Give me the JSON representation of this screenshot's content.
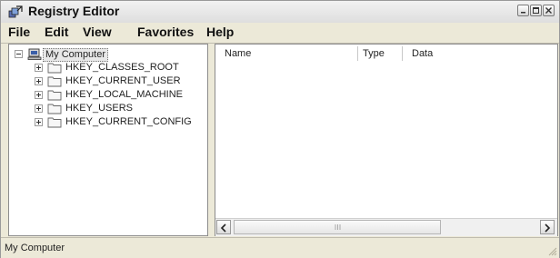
{
  "window": {
    "title": "Registry Editor",
    "icon": "registry-editor-icon"
  },
  "menu": {
    "items": [
      "File",
      "Edit",
      "View",
      "Favorites",
      "Help"
    ]
  },
  "tree": {
    "root": {
      "label": "My Computer",
      "icon": "computer-icon",
      "expanded": true
    },
    "children": [
      {
        "label": "HKEY_CLASSES_ROOT",
        "icon": "folder-icon"
      },
      {
        "label": "HKEY_CURRENT_USER",
        "icon": "folder-icon"
      },
      {
        "label": "HKEY_LOCAL_MACHINE",
        "icon": "folder-icon"
      },
      {
        "label": "HKEY_USERS",
        "icon": "folder-icon"
      },
      {
        "label": "HKEY_CURRENT_CONFIG",
        "icon": "folder-icon"
      }
    ]
  },
  "list": {
    "columns": [
      "Name",
      "Type",
      "Data"
    ]
  },
  "statusbar": {
    "text": "My Computer"
  }
}
